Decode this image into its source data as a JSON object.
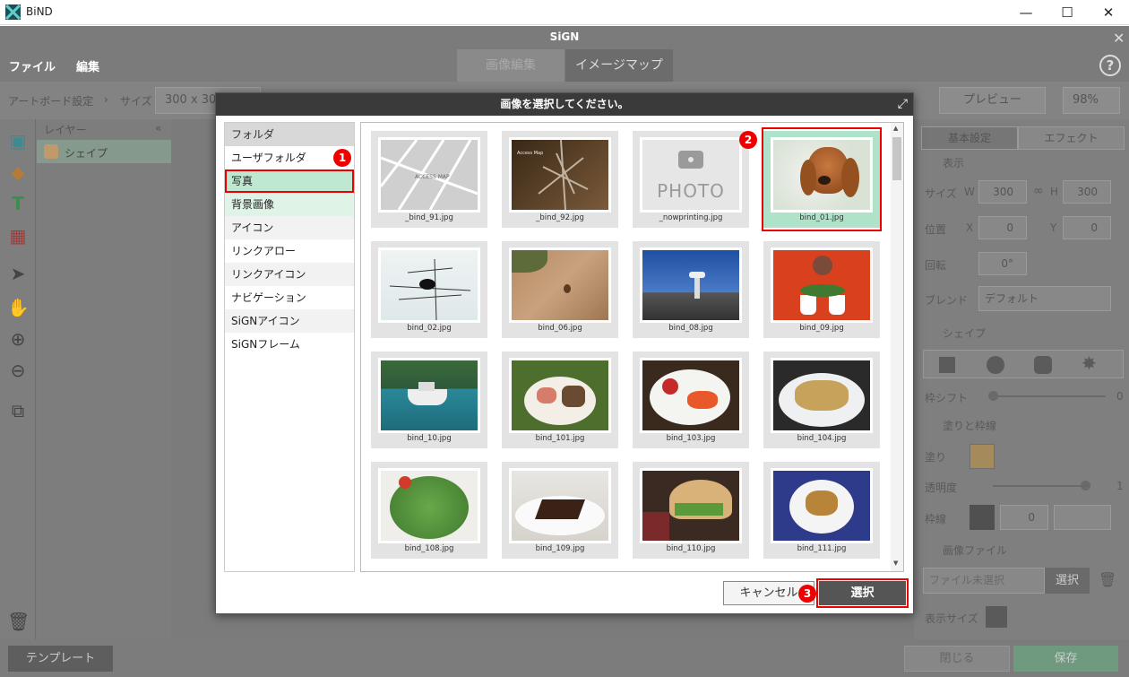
{
  "window": {
    "title": "BiND",
    "minimize": "—",
    "maximize": "☐",
    "close": "✕"
  },
  "app": {
    "title": "SiGN",
    "menu": [
      "ファイル",
      "編集"
    ],
    "tabs": [
      "画像編集",
      "イメージマップ"
    ],
    "toolbar": {
      "artboard": "アートボード設定",
      "separator": "›",
      "size_label": "サイズ",
      "size_value": "300 x 300",
      "preview": "プレビュー",
      "zoom": "98%"
    },
    "layers": {
      "header": "レイヤー",
      "collapse": "«",
      "item": "シェイプ"
    },
    "right_panel": {
      "tabs": [
        "基本設定",
        "エフェクト"
      ],
      "display_section": "表示",
      "size_label": "サイズ",
      "w": "W",
      "w_value": "300",
      "h": "H",
      "h_value": "300",
      "position_label": "位置",
      "x": "X",
      "x_value": "0",
      "y": "Y",
      "y_value": "0",
      "rotate_label": "回転",
      "rotate_value": "0°",
      "blend_label": "ブレンド",
      "blend_value": "デフォルト",
      "shape_section": "シェイプ",
      "frame_shift": "枠シフト",
      "frame_shift_value": "0",
      "fill_section": "塗りと枠線",
      "fill_label": "塗り",
      "opacity_label": "透明度",
      "opacity_value": "1",
      "stroke_label": "枠線",
      "stroke_value": "0",
      "image_section": "画像ファイル",
      "file_placeholder": "ファイル未選択",
      "file_select": "選択",
      "display_size": "表示サイズ"
    },
    "bottom": {
      "template": "テンプレート",
      "close": "閉じる",
      "save": "保存"
    }
  },
  "dialog": {
    "title": "画像を選択してください。",
    "folder_header": "フォルダ",
    "folders": [
      "ユーザフォルダ",
      "写真",
      "背景画像",
      "アイコン",
      "リンクアロー",
      "リンクアイコン",
      "ナビゲーション",
      "SiGNアイコン",
      "SiGNフレーム"
    ],
    "selected_folder": "写真",
    "images": [
      "_bind_91.jpg",
      "_bind_92.jpg",
      "_nowprinting.jpg",
      "bind_01.jpg",
      "bind_02.jpg",
      "bind_06.jpg",
      "bind_08.jpg",
      "bind_09.jpg",
      "bind_10.jpg",
      "bind_101.jpg",
      "bind_103.jpg",
      "bind_104.jpg",
      "bind_108.jpg",
      "bind_109.jpg",
      "bind_110.jpg",
      "bind_111.jpg"
    ],
    "selected_image": "bind_01.jpg",
    "thumb_texts": {
      "access_map": "ACCESS MAP",
      "access_map_small": "Access Map",
      "photo": "PHOTO"
    },
    "cancel": "キャンセル",
    "select": "選択",
    "badges": [
      "1",
      "2",
      "3"
    ]
  },
  "colors": {
    "accent_green": "#8ed8b0",
    "highlight_red": "#e00000",
    "fill_swatch": "#e8b466",
    "save_green": "#7fcf9f"
  }
}
